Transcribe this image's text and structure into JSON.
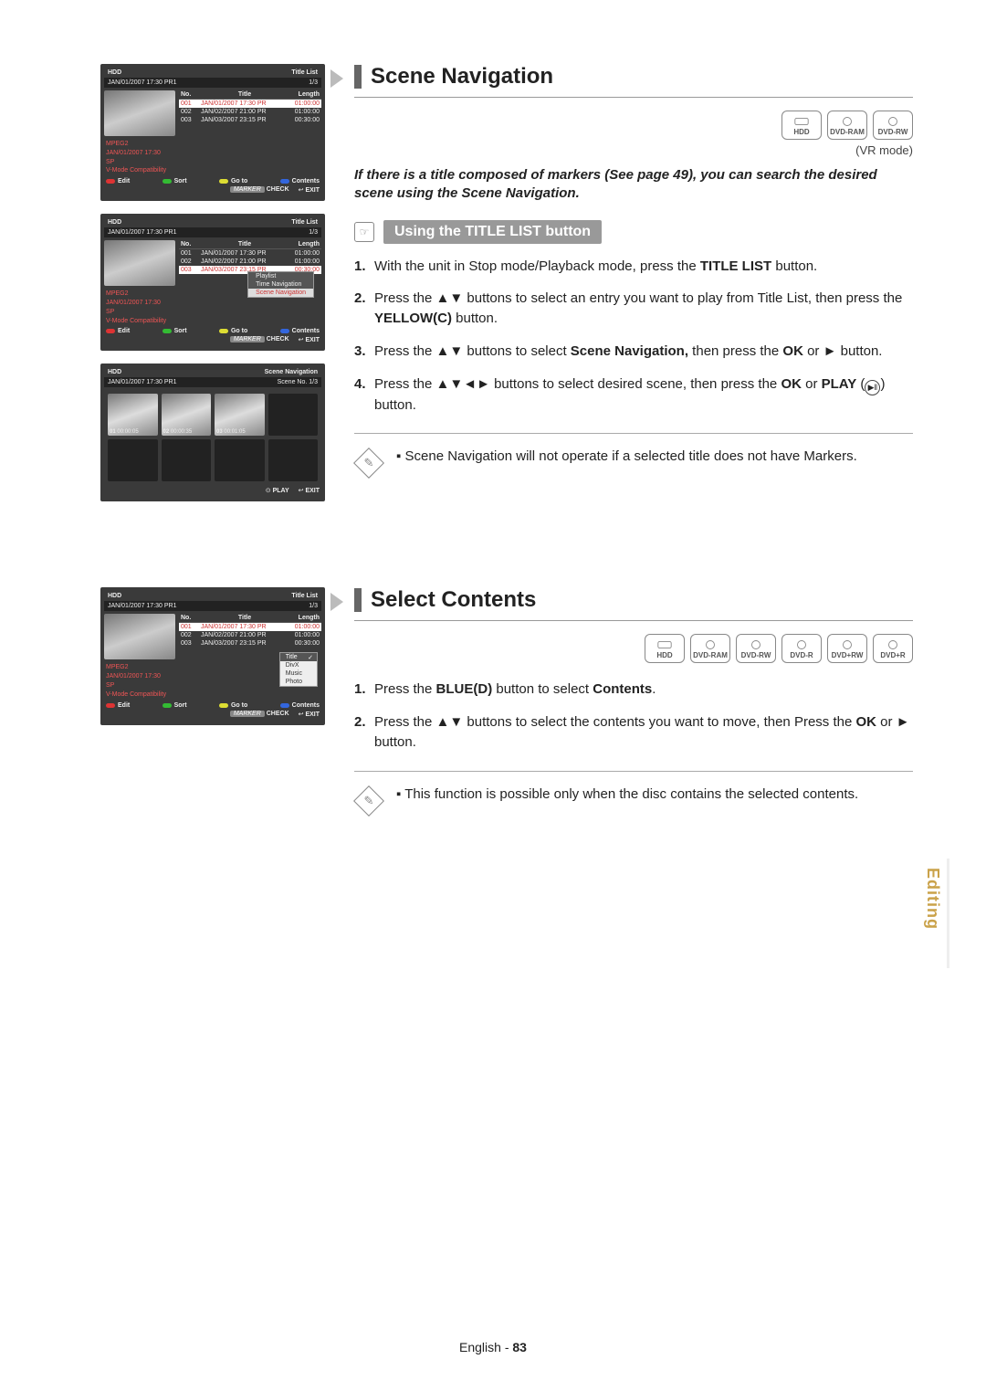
{
  "section1": {
    "title": "Scene Navigation",
    "badges": [
      "HDD",
      "DVD-RAM",
      "DVD-RW"
    ],
    "badges_note": "(VR mode)",
    "intro": "If there is a title composed of markers (See page 49), you can search the desired scene using the Scene Navigation.",
    "sub_title": "Using the TITLE LIST button",
    "steps": [
      {
        "pre": "With the unit in Stop mode/Playback mode, press the ",
        "bold": "TITLE LIST",
        "post": " button."
      },
      {
        "pre": "Press the ▲▼ buttons to select an entry you want to play from Title List, then press the ",
        "bold": "YELLOW(C)",
        "post": " button."
      },
      {
        "pre": "Press the ▲▼ buttons to select ",
        "bold": "Scene Navigation,",
        "mid": " then press the ",
        "bold2": "OK",
        "post2": " or ► button."
      },
      {
        "pre": "Press the ▲▼◄► buttons to select desired scene, then press the ",
        "bold": "OK",
        "mid": " or ",
        "bold2": "PLAY",
        "post2": " (",
        "icon": "▶ǁ",
        "post3": ") button."
      }
    ],
    "note": "Scene Navigation will not operate if a selected title does not have Markers."
  },
  "section2": {
    "title": "Select Contents",
    "badges": [
      "HDD",
      "DVD-RAM",
      "DVD-RW",
      "DVD-R",
      "DVD+RW",
      "DVD+R"
    ],
    "steps": [
      {
        "pre": "Press the ",
        "bold": "BLUE(D)",
        "mid": " button to select ",
        "bold2": "Contents",
        "post2": "."
      },
      {
        "pre": "Press the ▲▼ buttons to select the contents you want to move, then Press the ",
        "bold": "OK",
        "post": " or ► button."
      }
    ],
    "note": "This function is possible only when the disc contains the selected contents."
  },
  "mocks": {
    "header_storage": "HDD",
    "header_right1": "Title List",
    "sub_left": "JAN/01/2007 17:30 PR1",
    "sub_right": "1/3",
    "cols": {
      "no": "No.",
      "title": "Title",
      "len": "Length"
    },
    "rows": [
      {
        "no": "001",
        "title": "JAN/01/2007 17:30 PR",
        "len": "01:00:00"
      },
      {
        "no": "002",
        "title": "JAN/02/2007 21:00 PR",
        "len": "01:00:00"
      },
      {
        "no": "003",
        "title": "JAN/03/2007 23:15 PR",
        "len": "00:30:00"
      }
    ],
    "info": {
      "codec": "MPEG2",
      "date": "JAN/01/2007 17:30",
      "sp": "SP",
      "vmode": "V-Mode Compatibility"
    },
    "foot": {
      "edit": "Edit",
      "sort": "Sort",
      "goto": "Go to",
      "contents": "Contents",
      "check": "CHECK",
      "marker": "MARKER",
      "exit": "EXIT",
      "play": "PLAY"
    },
    "popup2": [
      "Playlist",
      "Time Navigation",
      "Scene Navigation"
    ],
    "scene_header": "Scene Navigation",
    "scene_sub": "Scene No. 1/3",
    "scene_labels": [
      {
        "n": "01",
        "t": "00:00:05"
      },
      {
        "n": "02",
        "t": "00:00:35"
      },
      {
        "n": "03",
        "t": "00:01:05"
      }
    ],
    "content_popup": [
      "Title",
      "DivX",
      "Music",
      "Photo"
    ]
  },
  "side_tab": "Editing",
  "footer": {
    "lang": "English",
    "sep": " - ",
    "page": "83"
  }
}
